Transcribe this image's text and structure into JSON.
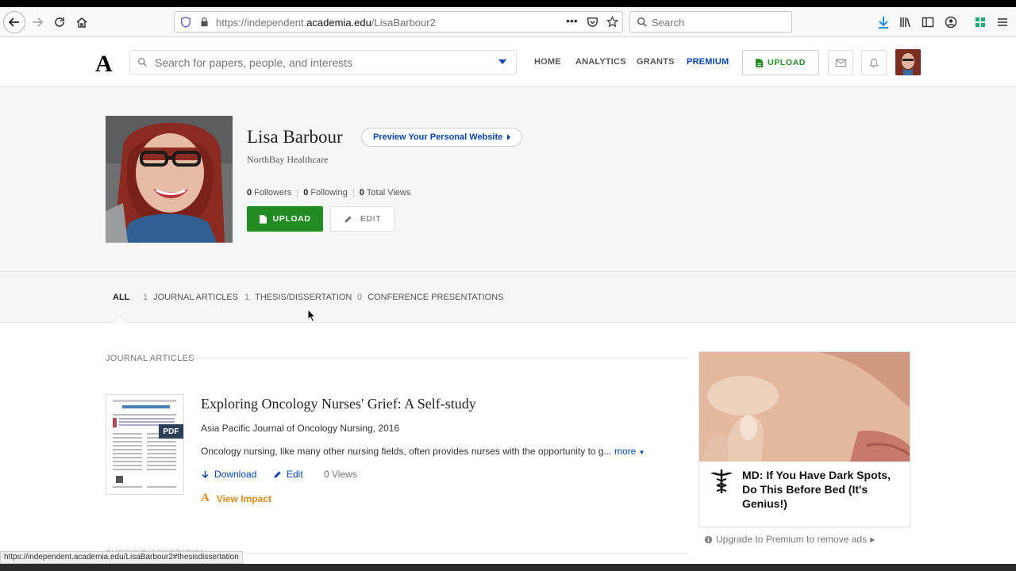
{
  "browser": {
    "url_prefix": "https://independent.",
    "url_domain": "academia.edu",
    "url_path": "/LisaBarbour2",
    "search_placeholder": "Search",
    "status_link": "https://independent.academia.edu/LisaBarbour2#thesisdissertation"
  },
  "header": {
    "logo": "A",
    "search_placeholder": "Search for papers, people, and interests",
    "nav": [
      "HOME",
      "ANALYTICS",
      "GRANTS",
      "PREMIUM"
    ],
    "upload_label": "UPLOAD"
  },
  "profile": {
    "name": "Lisa Barbour",
    "preview_label": "Preview Your Personal Website",
    "affiliation": "NorthBay Healthcare",
    "followers_count": "0",
    "followers_label": "Followers",
    "following_count": "0",
    "following_label": "Following",
    "views_count": "0",
    "views_label": "Total Views",
    "upload_label": "UPLOAD",
    "edit_label": "EDIT"
  },
  "tabs": [
    {
      "count": "",
      "label": "ALL"
    },
    {
      "count": "1",
      "label": "JOURNAL ARTICLES"
    },
    {
      "count": "1",
      "label": "THESIS/DISSERTATION"
    },
    {
      "count": "0",
      "label": "CONFERENCE PRESENTATIONS"
    }
  ],
  "section": {
    "heading": "JOURNAL ARTICLES",
    "next_heading": "THESIS/DISSERTATION"
  },
  "paper": {
    "title": "Exploring Oncology Nurses' Grief: A Self-study",
    "journal": "Asia Pacific Journal of Oncology Nursing, 2016",
    "abstract": "Oncology nursing, like many other nursing fields, often provides nurses with the opportunity to g...",
    "more_label": "more",
    "badge": "PDF",
    "download_label": "Download",
    "edit_label": "Edit",
    "views": "0 Views",
    "impact_label": "View Impact"
  },
  "ad": {
    "headline": "MD: If You Have Dark Spots, Do This Before Bed (It's Genius!)",
    "upgrade_label": "Upgrade to Premium to remove ads"
  },
  "colors": {
    "brand_blue": "#0645b1",
    "upload_green": "#228b22",
    "impact_orange": "#e08a1e"
  }
}
